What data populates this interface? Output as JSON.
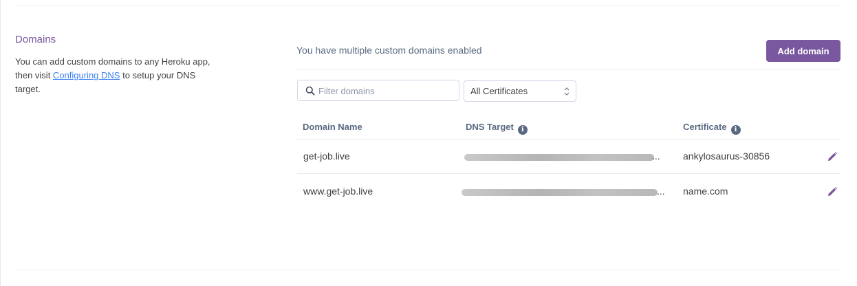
{
  "section": {
    "title": "Domains",
    "desc_before": "You can add custom domains to any Heroku app, then visit ",
    "link": "Configuring DNS",
    "desc_after": " to setup your DNS target."
  },
  "header": {
    "headline": "You have multiple custom domains enabled",
    "add_button": "Add domain"
  },
  "filter": {
    "placeholder": "Filter domains",
    "certificate_select": "All Certificates"
  },
  "table": {
    "columns": [
      "Domain Name",
      "DNS Target",
      "Certificate"
    ],
    "rows": [
      {
        "domain": "get-job.live",
        "dns_target_suffix": "...",
        "certificate": "ankylosaurus-30856"
      },
      {
        "domain": "www.get-job.live",
        "dns_target_suffix": "...",
        "certificate": "name.com"
      }
    ]
  },
  "colors": {
    "accent": "#79589f",
    "link": "#3b82f6",
    "muted": "#596981"
  }
}
